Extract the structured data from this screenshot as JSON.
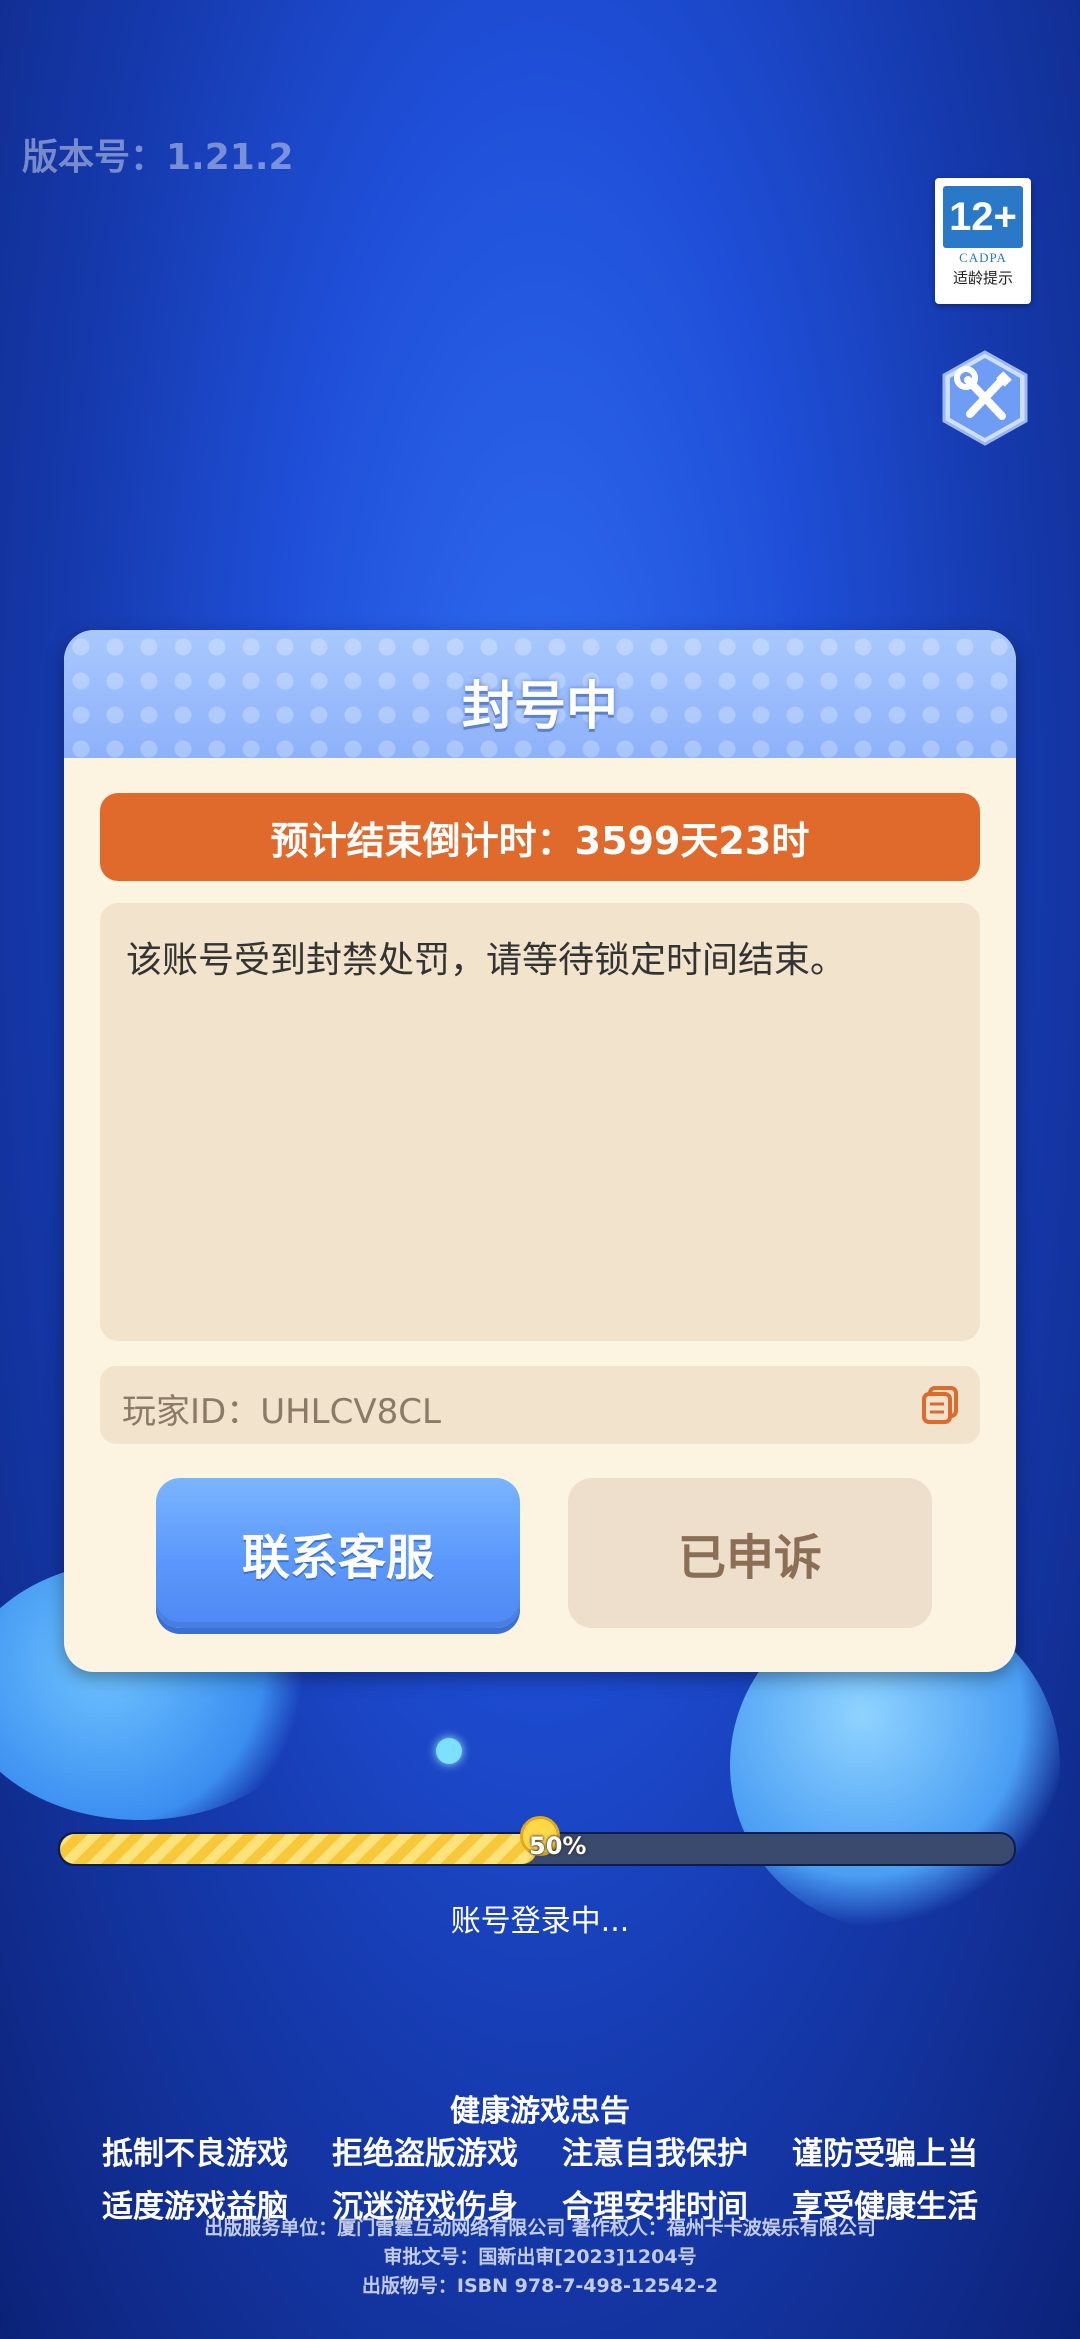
{
  "version_label": "版本号：1.21.2",
  "age_badge": {
    "rating": "12+",
    "org": "CADPA",
    "tip": "适龄提示"
  },
  "dialog": {
    "title": "封号中",
    "countdown": "预计结束倒计时：3599天23时",
    "message": "该账号受到封禁处罚，请等待锁定时间结束。",
    "player_id_label": "玩家ID：UHLCV8CL",
    "contact_button": "联系客服",
    "appealed_button": "已申诉"
  },
  "progress": {
    "percent": 50,
    "label": "50%"
  },
  "loading_text": "账号登录中...",
  "health_notice": {
    "title": "健康游戏忠告",
    "lines": [
      "抵制不良游戏",
      "拒绝盗版游戏",
      "注意自我保护",
      "谨防受骗上当",
      "适度游戏益脑",
      "沉迷游戏伤身",
      "合理安排时间",
      "享受健康生活"
    ]
  },
  "credits": {
    "line1": "出版服务单位：厦门雷霆互动网络有限公司    著作权人：福州卡卡波娱乐有限公司",
    "line2": "审批文号：国新出审[2023]1204号",
    "line3": "出版物号：ISBN 978-7-498-12542-2"
  },
  "colors": {
    "countdown_bg": "#e06a2b",
    "contact_btn": "#5b98fb",
    "dialog_bg": "#fdf3e1"
  }
}
